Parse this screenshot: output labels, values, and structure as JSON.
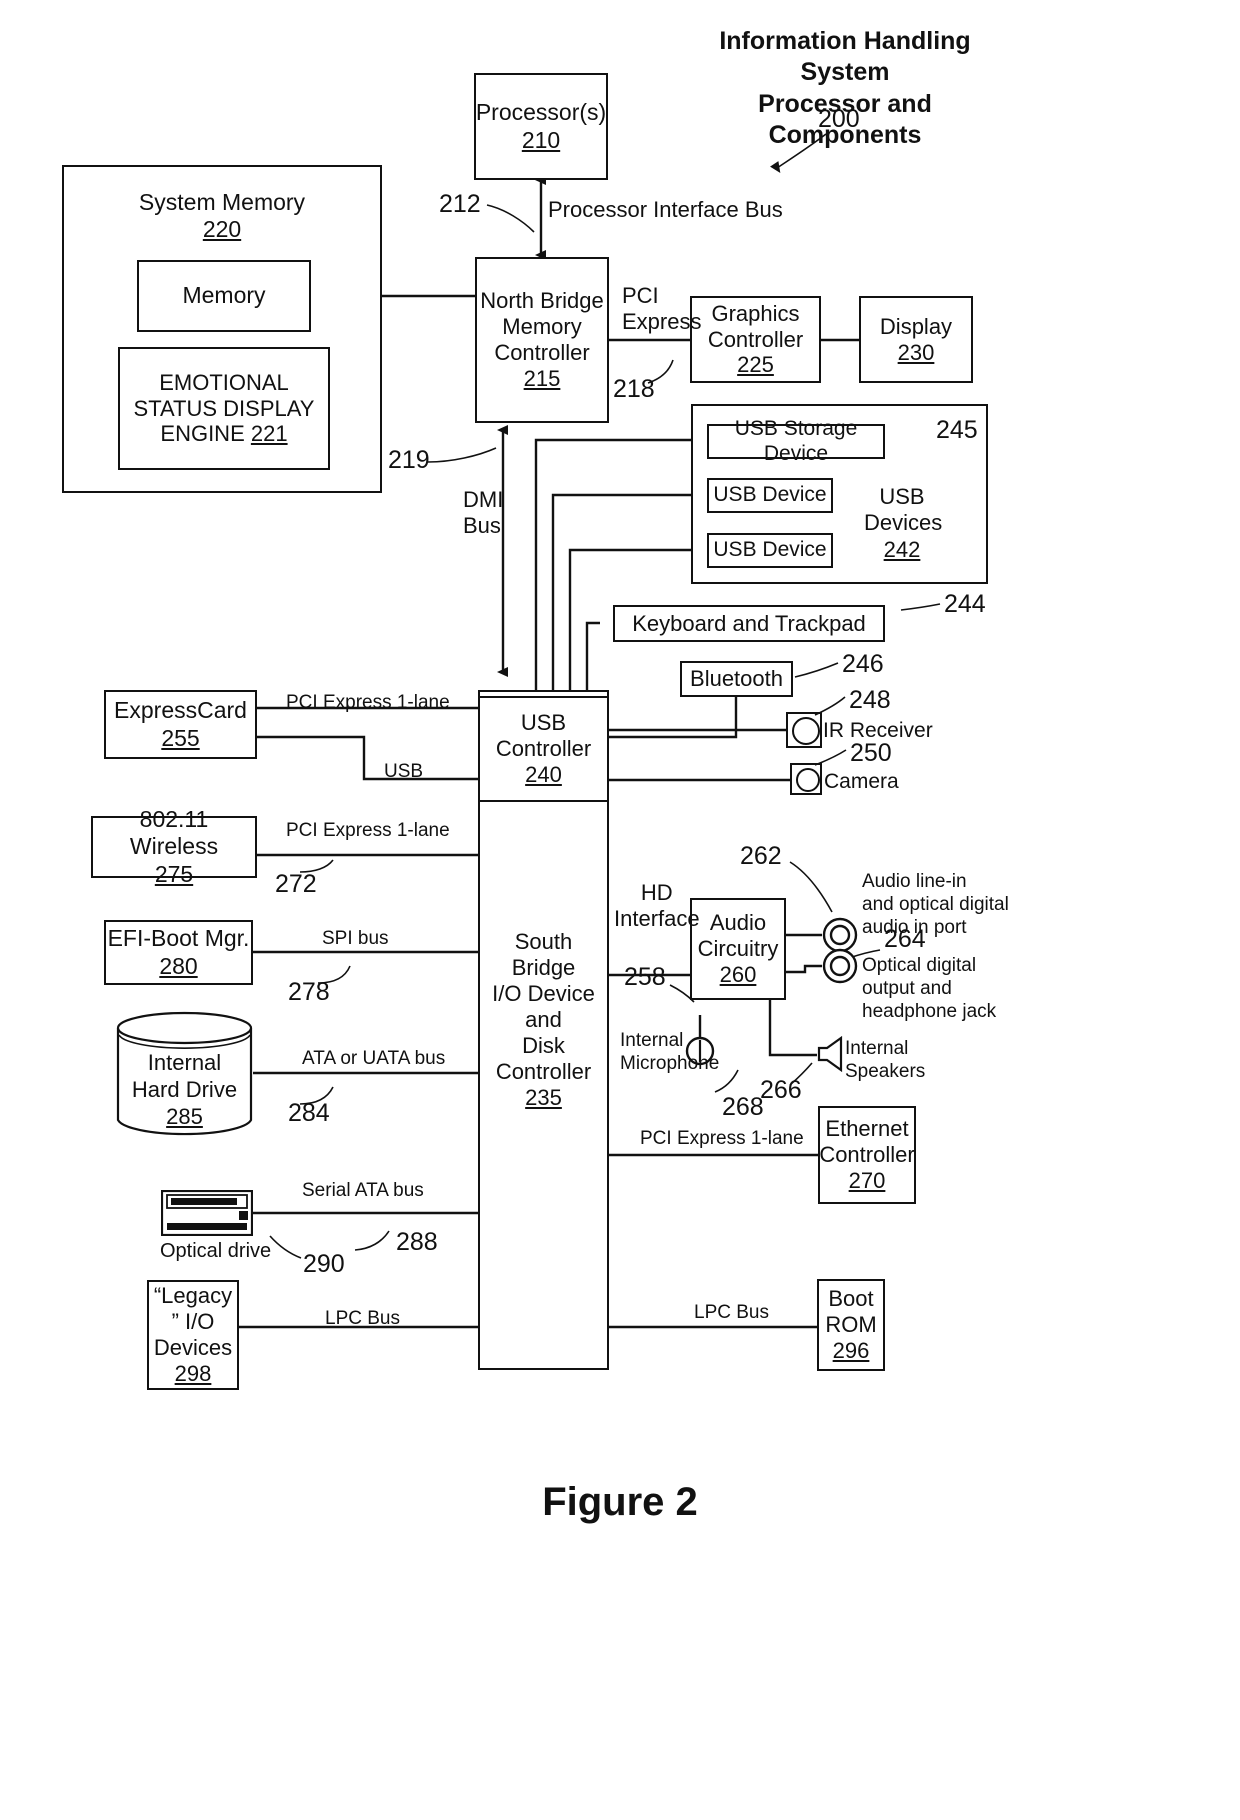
{
  "figure": {
    "caption": "Figure 2"
  },
  "title_block": {
    "line1": "Information Handling",
    "line2": "System",
    "line3": "Processor and Components",
    "ref": "200"
  },
  "blocks": {
    "processor": {
      "title": "Processor(s)",
      "num": "210"
    },
    "system_memory": {
      "title": "System Memory",
      "num": "220"
    },
    "memory": {
      "title": "Memory",
      "num": ""
    },
    "esde": {
      "line1": "EMOTIONAL",
      "line2": "STATUS DISPLAY",
      "line3": "ENGINE",
      "num": "221"
    },
    "north_bridge": {
      "l1": "North Bridge",
      "l2": "Memory",
      "l3": "Controller",
      "num": "215"
    },
    "graphics": {
      "l1": "Graphics",
      "l2": "Controller",
      "num": "225"
    },
    "display": {
      "title": "Display",
      "num": "230"
    },
    "usb_storage": {
      "title": "USB Storage Device"
    },
    "usb_device_1": {
      "title": "USB Device"
    },
    "usb_device_2": {
      "title": "USB Device"
    },
    "usb_devices_grp": {
      "l1": "USB",
      "l2": "Devices",
      "num": "242"
    },
    "keyboard": {
      "title": "Keyboard and Trackpad"
    },
    "bluetooth": {
      "title": "Bluetooth"
    },
    "ir_receiver": {
      "title": "IR Receiver"
    },
    "camera": {
      "title": "Camera"
    },
    "usb_controller": {
      "l1": "USB",
      "l2": "Controller",
      "num": "240"
    },
    "expresscard": {
      "title": "ExpressCard",
      "num": "255"
    },
    "wireless": {
      "title": "802.11 Wireless",
      "num": "275"
    },
    "efi": {
      "title": "EFI-Boot Mgr.",
      "num": "280"
    },
    "hard_drive": {
      "l1": "Internal",
      "l2": "Hard Drive",
      "num": "285"
    },
    "optical_drive": {
      "title": "Optical drive",
      "ref": "290"
    },
    "legacy_io": {
      "l1": "“Legacy",
      "l2": "” I/O",
      "l3": "Devices",
      "num": "298"
    },
    "south_bridge": {
      "l1": "South Bridge",
      "l2": "I/O Device",
      "l3": "and",
      "l4": "Disk",
      "l5": "Controller",
      "num": "235"
    },
    "audio": {
      "l1": "Audio",
      "l2": "Circuitry",
      "num": "260"
    },
    "ethernet": {
      "l1": "Ethernet",
      "l2": "Controller",
      "num": "270"
    },
    "boot_rom": {
      "l1": "Boot",
      "l2": "ROM",
      "num": "296"
    }
  },
  "bus_labels": {
    "processor_interface": "Processor Interface Bus",
    "pci_express_nb": "PCI\nExpress",
    "pci_express_1": "PCI\nExpress",
    "dmi_bus": "DMI\nBus",
    "pcie_1lane_express": "PCI Express 1-lane",
    "usb": "USB",
    "pcie_1lane_wireless": "PCI Express 1-lane",
    "spi_bus": "SPI bus",
    "ata_bus": "ATA or UATA bus",
    "serial_ata": "Serial ATA bus",
    "lpc_bus_left": "LPC Bus",
    "lpc_bus_right": "LPC Bus",
    "pcie_1lane_ethernet": "PCI Express 1-lane",
    "hd_interface": "HD\nInterface"
  },
  "ref_numbers": {
    "r212": "212",
    "r218": "218",
    "r219": "219",
    "r245": "245",
    "r244": "244",
    "r246": "246",
    "r248": "248",
    "r250": "250",
    "r272": "272",
    "r278": "278",
    "r284": "284",
    "r288": "288",
    "r290": "290",
    "r258": "258",
    "r262": "262",
    "r264": "264",
    "r266": "266",
    "r268": "268"
  },
  "port_labels": {
    "audio_in": "Audio line-in\nand optical digital\naudio in port",
    "optical_out": "Optical digital\noutput and\nheadphone jack",
    "internal_microphone": "Internal\nMicrophone",
    "internal_speakers": "Internal\nSpeakers"
  },
  "colors": {
    "ink": "#111111",
    "paper": "#ffffff"
  }
}
